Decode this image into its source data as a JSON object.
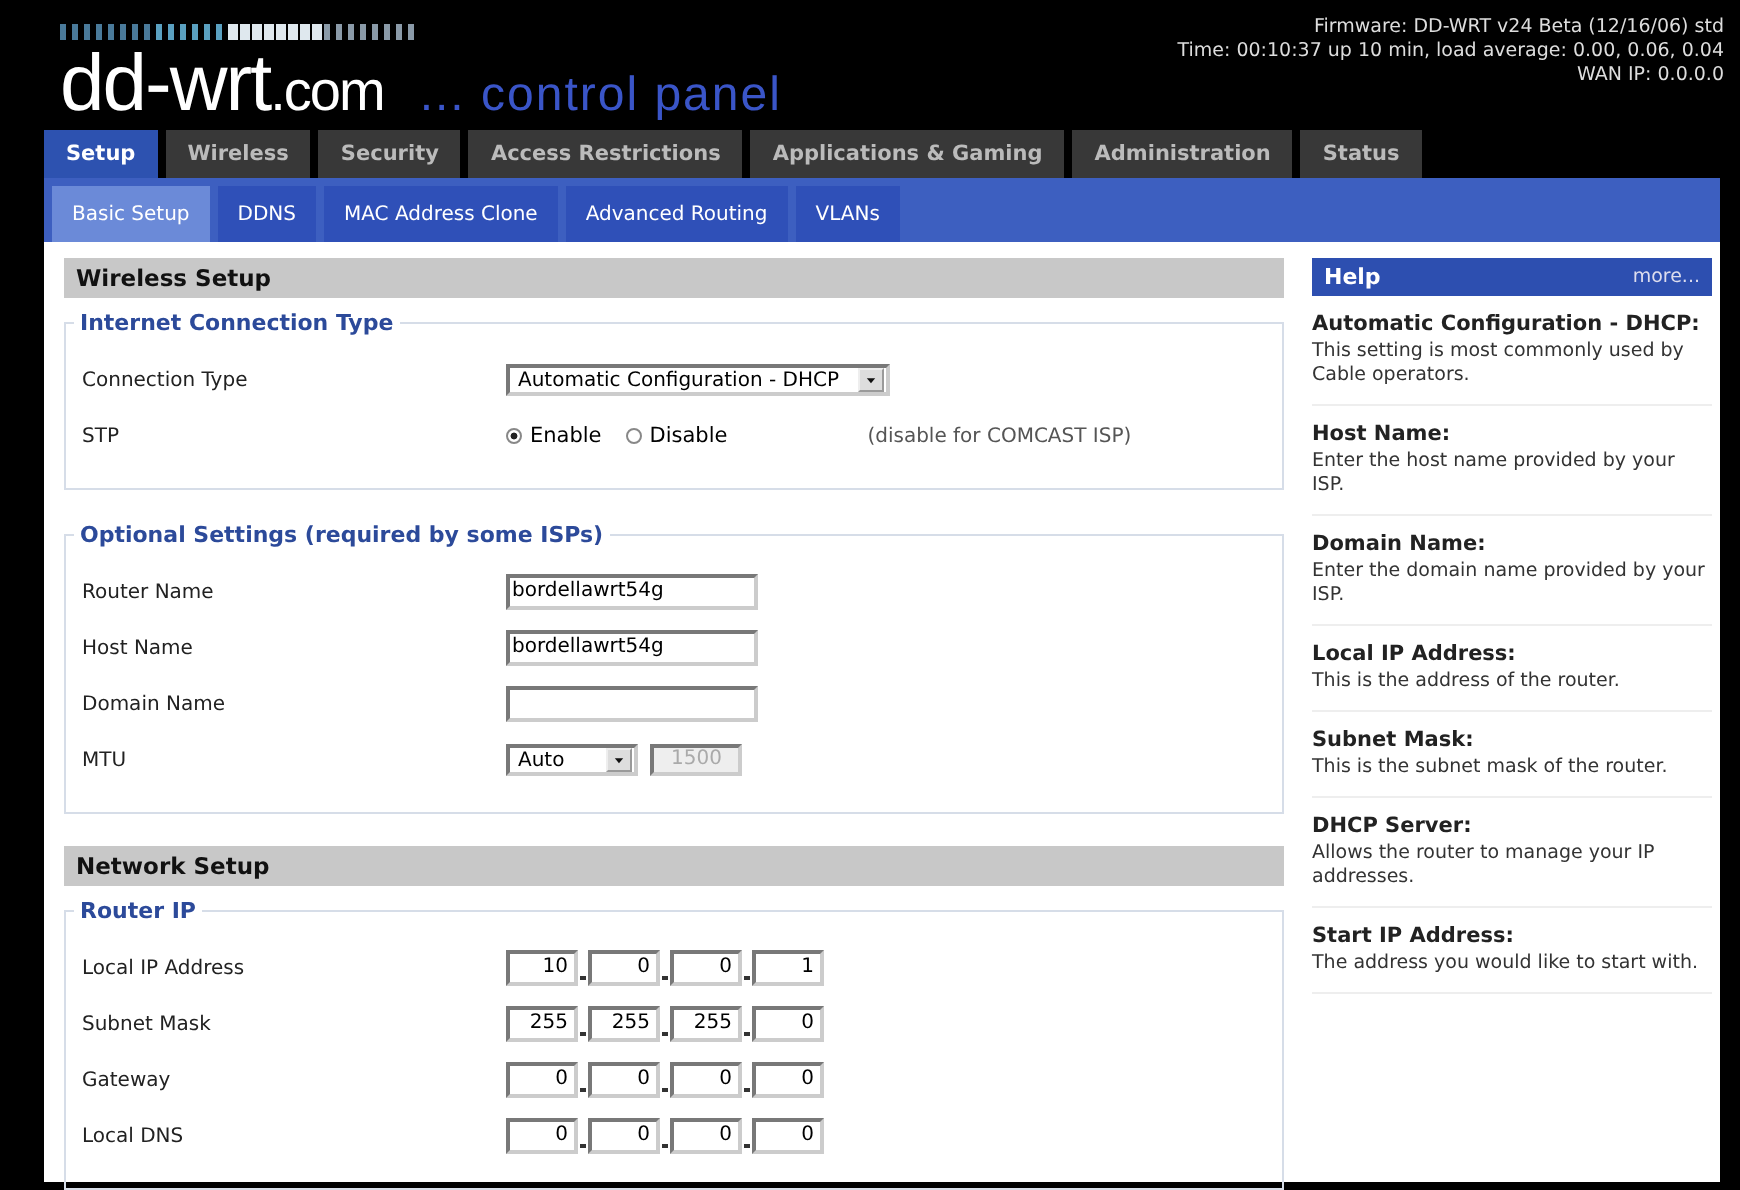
{
  "header": {
    "logo": "dd-wrt",
    "logo_suffix": ".com",
    "tagline": "... control panel",
    "info": [
      "Firmware: DD-WRT v24 Beta (12/16/06) std",
      "Time: 00:10:37 up 10 min, load average: 0.00, 0.06, 0.04",
      "WAN IP: 0.0.0.0"
    ]
  },
  "tabs": [
    {
      "label": "Setup",
      "selected": true
    },
    {
      "label": "Wireless",
      "selected": false
    },
    {
      "label": "Security",
      "selected": false
    },
    {
      "label": "Access Restrictions",
      "selected": false
    },
    {
      "label": "Applications & Gaming",
      "selected": false
    },
    {
      "label": "Administration",
      "selected": false
    },
    {
      "label": "Status",
      "selected": false
    }
  ],
  "subtabs": [
    {
      "label": "Basic Setup",
      "selected": true
    },
    {
      "label": "DDNS",
      "selected": false
    },
    {
      "label": "MAC Address Clone",
      "selected": false
    },
    {
      "label": "Advanced Routing",
      "selected": false
    },
    {
      "label": "VLANs",
      "selected": false
    }
  ],
  "sections": [
    {
      "title": "Wireless Setup",
      "fieldsets": [
        {
          "legend": "Internet Connection Type",
          "rows": [
            {
              "label": "Connection Type",
              "kind": "select",
              "value": "Automatic Configuration - DHCP"
            },
            {
              "label": "STP",
              "kind": "radio",
              "options": [
                {
                  "label": "Enable",
                  "selected": true
                },
                {
                  "label": "Disable",
                  "selected": false
                }
              ],
              "note": "(disable for COMCAST ISP)"
            }
          ]
        },
        {
          "legend": "Optional Settings (required by some ISPs)",
          "rows": [
            {
              "label": "Router Name",
              "kind": "text",
              "value": "bordellawrt54g"
            },
            {
              "label": "Host Name",
              "kind": "text",
              "value": "bordellawrt54g"
            },
            {
              "label": "Domain Name",
              "kind": "text"
            },
            {
              "label": "MTU",
              "kind": "mtu",
              "value": "Auto",
              "number": "1500",
              "disabled": true
            }
          ]
        }
      ]
    },
    {
      "title": "Network Setup",
      "fieldsets": [
        {
          "legend": "Router IP",
          "rows": [
            {
              "label": "Local IP Address",
              "kind": "ip",
              "octets": [
                "10",
                "0",
                "0",
                "1"
              ]
            },
            {
              "label": "Subnet Mask",
              "kind": "ip",
              "octets": [
                "255",
                "255",
                "255",
                "0"
              ]
            },
            {
              "label": "Gateway",
              "kind": "ip",
              "octets": [
                "0",
                "0",
                "0",
                "0"
              ]
            },
            {
              "label": "Local DNS",
              "kind": "ip",
              "octets": [
                "0",
                "0",
                "0",
                "0"
              ]
            }
          ]
        }
      ]
    }
  ],
  "help": {
    "title": "Help",
    "more": "more...",
    "items": [
      {
        "title": "Automatic Configuration - DHCP:",
        "text": "This setting is most commonly used by Cable operators."
      },
      {
        "title": "Host Name:",
        "text": "Enter the host name provided by your ISP."
      },
      {
        "title": "Domain Name:",
        "text": "Enter the domain name provided by your ISP."
      },
      {
        "title": "Local IP Address:",
        "text": "This is the address of the router."
      },
      {
        "title": "Subnet Mask:",
        "text": "This is the subnet mask of the router."
      },
      {
        "title": "DHCP Server:",
        "text": "Allows the router to manage your IP addresses."
      },
      {
        "title": "Start IP Address:",
        "text": "The address you would like to start with."
      }
    ]
  }
}
